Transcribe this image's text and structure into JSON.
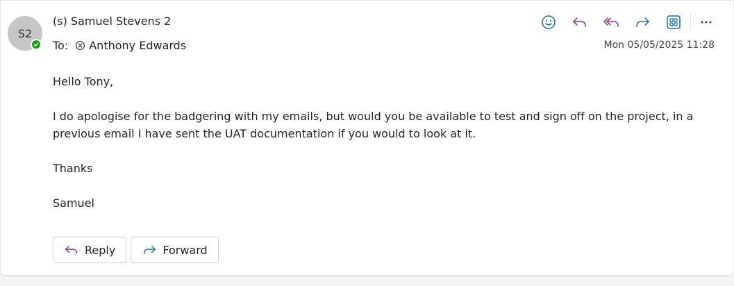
{
  "sender": {
    "initials": "S2",
    "name": "(s) Samuel Stevens 2",
    "presence_color": "#13a10e"
  },
  "recipients": {
    "label": "To:",
    "items": [
      {
        "name": "Anthony Edwards"
      }
    ]
  },
  "timestamp": "Mon 05/05/2025 11:28",
  "toolbar": {
    "icons": [
      "emoji-icon",
      "reply-icon",
      "reply-all-icon",
      "forward-icon",
      "apps-icon",
      "more-icon"
    ],
    "reply_color": "#8a2a8a",
    "forward_color": "#0f6cbd"
  },
  "body": {
    "greeting": "Hello Tony,",
    "paragraph": "I do apologise for the badgering with my emails, but would you be available to test and sign off on the project, in a previous email I have sent the UAT documentation if you would to look at it.",
    "closing": "Thanks",
    "signature": "Samuel"
  },
  "actions": {
    "reply_label": "Reply",
    "forward_label": "Forward"
  }
}
